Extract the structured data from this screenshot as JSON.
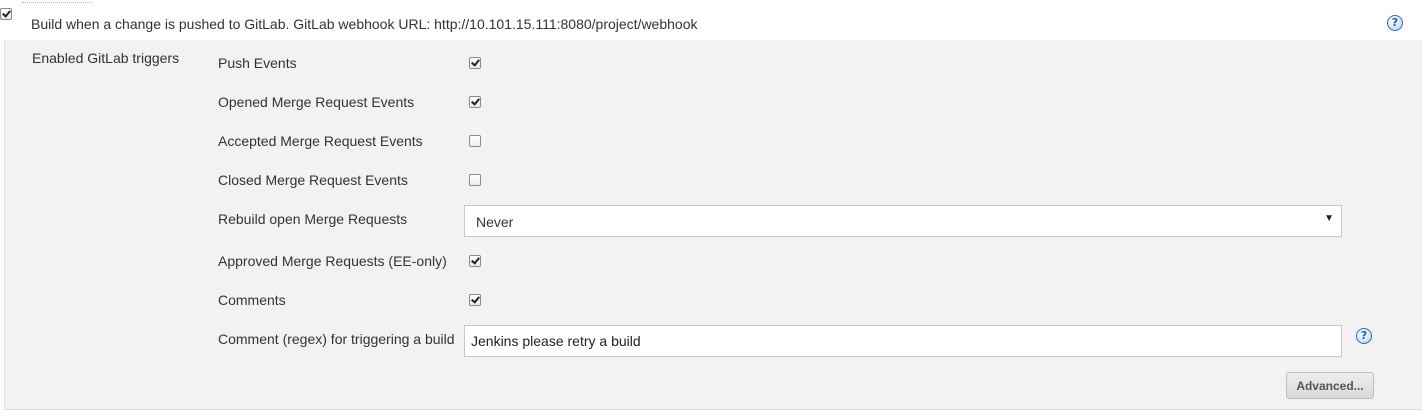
{
  "header": {
    "build_trigger_checked": true,
    "build_trigger_label": "Build when a change is pushed to GitLab. GitLab webhook URL: http://10.101.15.111:8080/project/webhook",
    "help_icon": "help-icon"
  },
  "triggers": {
    "section_label": "Enabled GitLab triggers",
    "options": [
      {
        "label": "Push Events",
        "checked": true
      },
      {
        "label": "Opened Merge Request Events",
        "checked": true
      },
      {
        "label": "Accepted Merge Request Events",
        "checked": false
      },
      {
        "label": "Closed Merge Request Events",
        "checked": false
      }
    ],
    "rebuild": {
      "label": "Rebuild open Merge Requests",
      "selected": "Never",
      "arrow_icon": "dropdown-arrow-icon"
    },
    "options2": [
      {
        "label": "Approved Merge Requests (EE-only)",
        "checked": true
      },
      {
        "label": "Comments",
        "checked": true
      }
    ],
    "comment": {
      "label": "Comment (regex) for triggering a build",
      "value": "Jenkins please retry a build",
      "help_icon": "help-icon"
    },
    "advanced_button": "Advanced..."
  },
  "colors": {
    "panel_background": "#f2f2f2",
    "help_icon_blue": "#1f5fa8",
    "text": "#333333"
  }
}
